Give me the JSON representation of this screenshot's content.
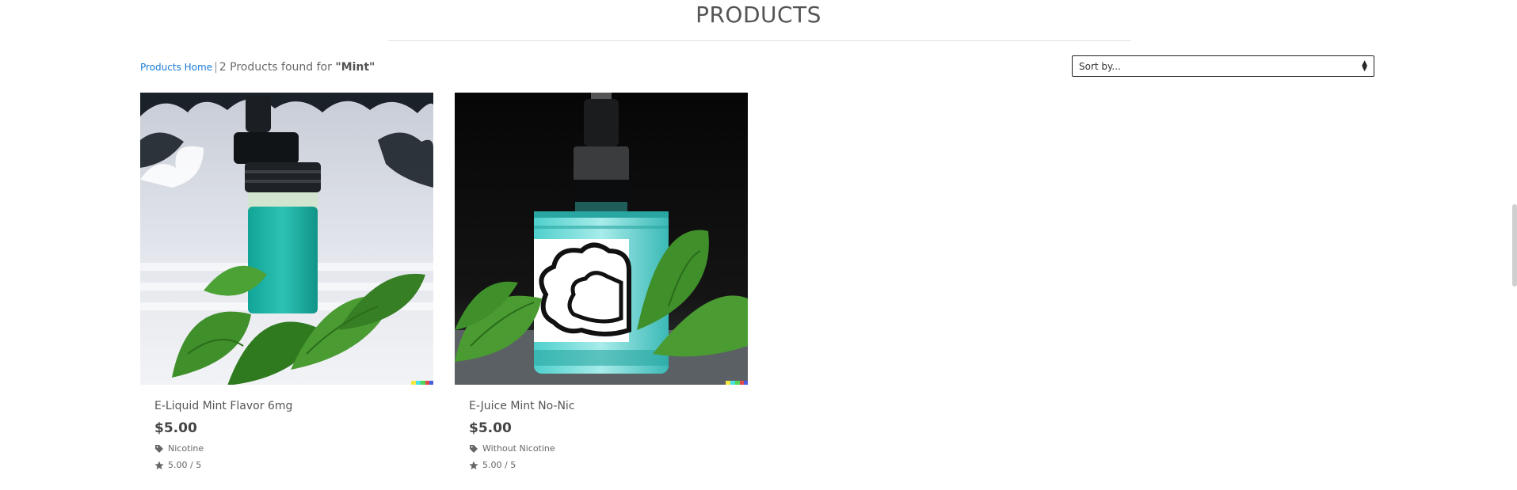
{
  "page": {
    "title": "PRODUCTS"
  },
  "breadcrumb": {
    "home_label": "Products Home",
    "separator": "|",
    "results_prefix": "2 Products found for",
    "query": "\"Mint\""
  },
  "sort": {
    "selected": "Sort by..."
  },
  "products": [
    {
      "name": "E-Liquid Mint Flavor 6mg",
      "price": "$5.00",
      "category": "Nicotine",
      "rating": "5.00 / 5",
      "image_icon": "mint-bottle-image"
    },
    {
      "name": "E-Juice Mint No-Nic",
      "price": "$5.00",
      "category": "Without Nicotine",
      "rating": "5.00 / 5",
      "image_icon": "mint-bottle-image"
    }
  ],
  "colors": {
    "link": "#1a7ad4",
    "liquid_teal": "#1fb5a8",
    "leaf_green": "#3f8f2a"
  }
}
